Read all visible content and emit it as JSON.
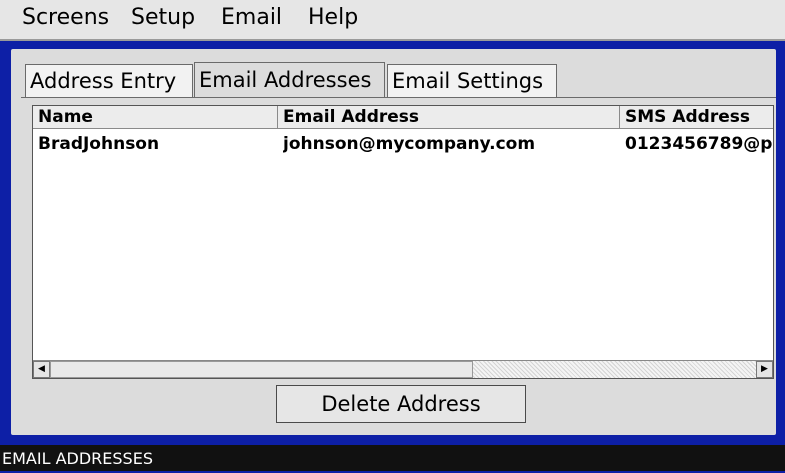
{
  "menu": {
    "items": [
      "Screens",
      "Setup",
      "Email",
      "Help"
    ]
  },
  "tabs": [
    {
      "label": "Address Entry",
      "active": false
    },
    {
      "label": "Email Addresses",
      "active": true
    },
    {
      "label": "Email Settings",
      "active": false
    }
  ],
  "table": {
    "columns": [
      "Name",
      "Email Address",
      "SMS Address"
    ],
    "rows": [
      [
        "BradJohnson",
        "johnson@mycompany.com",
        "0123456789@p"
      ]
    ]
  },
  "actions": {
    "delete_label": "Delete Address"
  },
  "status": {
    "text": "EMAIL ADDRESSES"
  },
  "colors": {
    "background": "#0d1fa6",
    "panel": "#dcdcdc",
    "status_bar": "#111111"
  }
}
